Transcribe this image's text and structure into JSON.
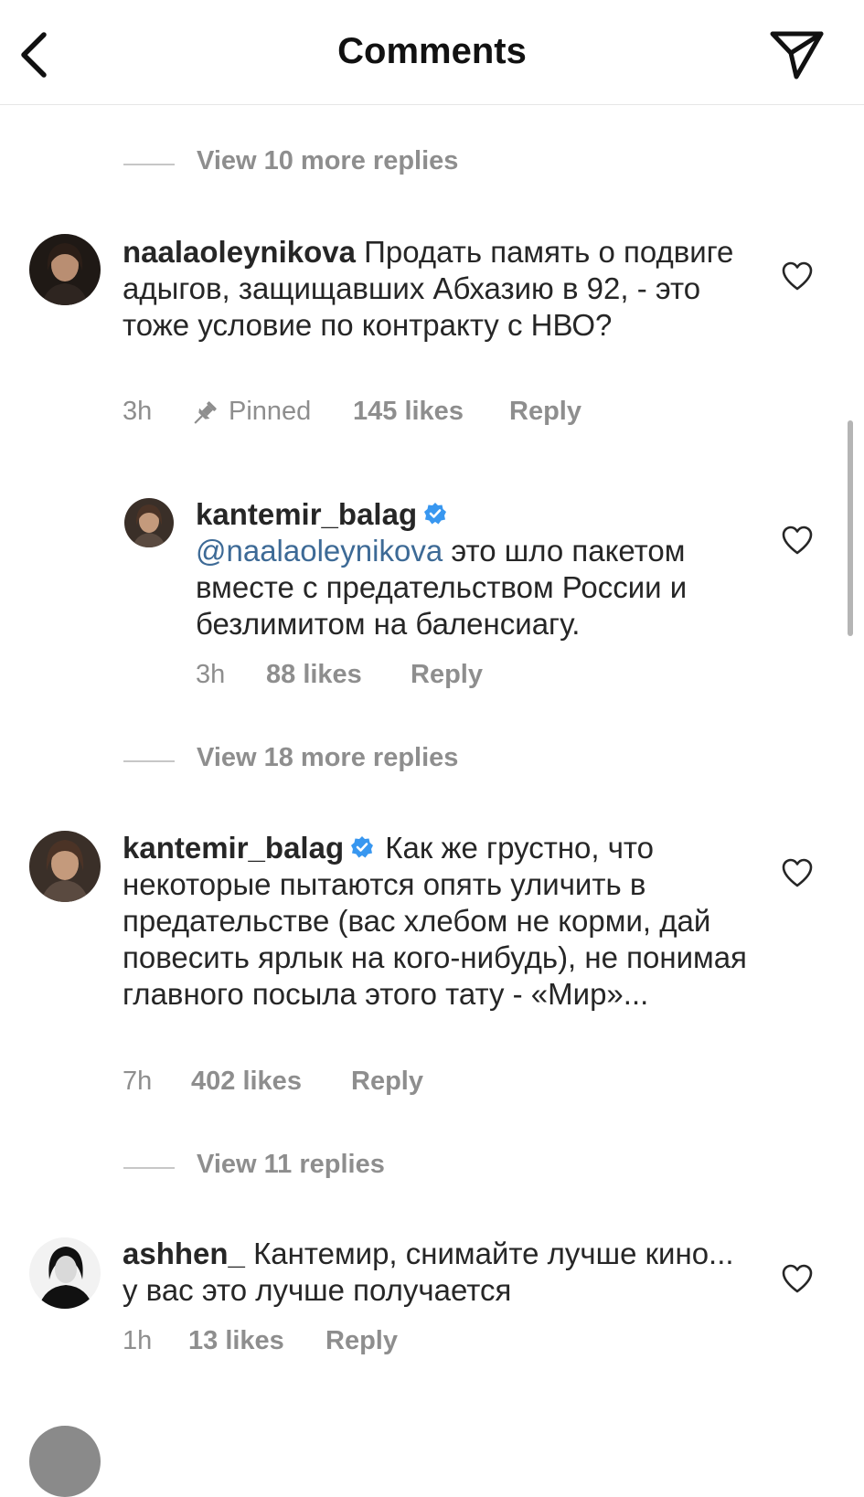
{
  "header": {
    "title": "Comments",
    "back_icon": "chevron-left-icon",
    "share_icon": "paper-plane-icon"
  },
  "view_more_1": {
    "label": "View 10 more replies"
  },
  "comment_1": {
    "username": "naalaoleynikova",
    "text": "Продать память о подвиге адыгов, защищавших Абхазию в 92, - это тоже условие по контракту с НВО?",
    "time": "3h",
    "pinned": "Pinned",
    "likes": "145 likes",
    "reply": "Reply"
  },
  "reply_1": {
    "username": "kantemir_balag",
    "mention": "@naalaoleynikova",
    "text": " это шло пакетом вместе с предательством России и безлимитом на баленсиагу.",
    "time": "3h",
    "likes": "88 likes",
    "reply": "Reply"
  },
  "view_more_2": {
    "label": "View 18 more replies"
  },
  "comment_2": {
    "username": "kantemir_balag",
    "text": "Как же грустно, что некоторые пытаются опять уличить в предательстве (вас хлебом не корми, дай повесить ярлык на кого-нибудь), не понимая главного посыла этого тату - «Мир»...",
    "time": "7h",
    "likes": "402 likes",
    "reply": "Reply"
  },
  "view_more_3": {
    "label": "View 11 replies"
  },
  "comment_3": {
    "username": "ashhen_",
    "text": "Кантемир, снимайте лучше кино... у вас это лучше получается",
    "time": "1h",
    "likes": "13 likes",
    "reply": "Reply"
  },
  "colors": {
    "text": "#262626",
    "secondary": "#8e8e8e",
    "mention": "#3d6a96",
    "verified": "#3897f0"
  }
}
